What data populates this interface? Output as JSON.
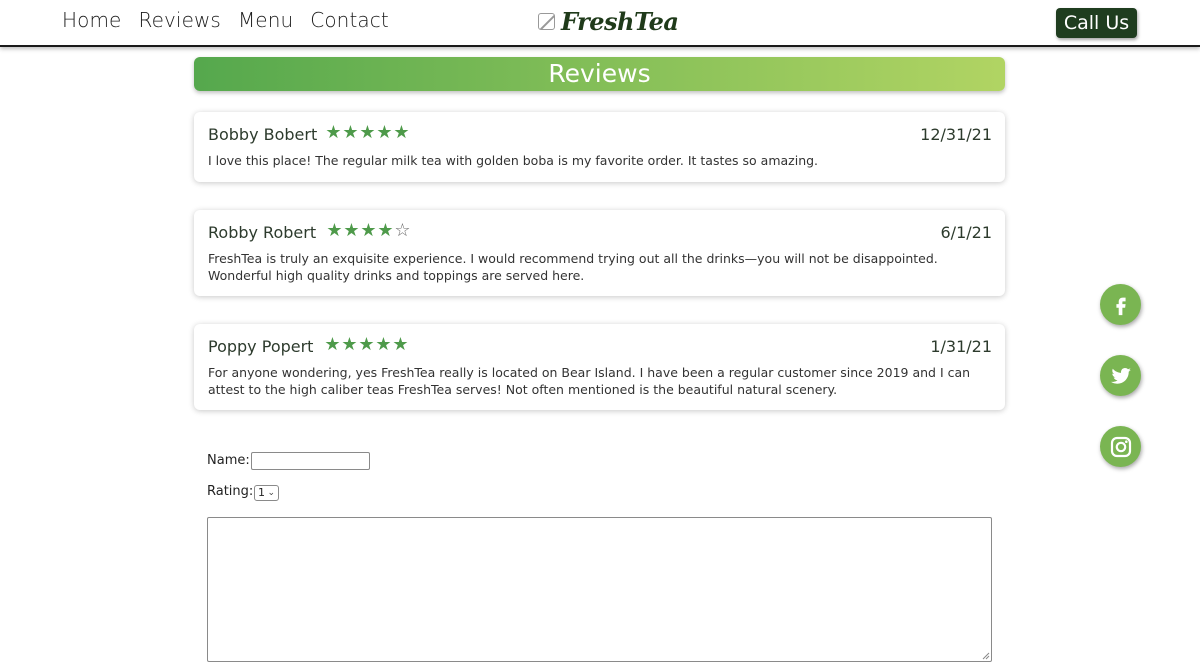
{
  "nav": {
    "items": [
      "Home",
      "Reviews",
      "Menu",
      "Contact"
    ]
  },
  "logo": {
    "text": "FreshTea",
    "icon": "leaf-square-icon"
  },
  "header": {
    "call_label": "Call Us"
  },
  "banner": {
    "title": "Reviews"
  },
  "reviews": [
    {
      "name": "Bobby Bobert",
      "rating": 5,
      "date": "12/31/21",
      "text": "I love this place! The regular milk tea with golden boba is my favorite order. It tastes so amazing."
    },
    {
      "name": "Robby Robert",
      "rating": 4,
      "date": "6/1/21",
      "text": "FreshTea is truly an exquisite experience. I would recommend trying out all the drinks—you will not be disappointed. Wonderful high quality drinks and toppings are served here."
    },
    {
      "name": "Poppy Popert",
      "rating": 5,
      "date": "1/31/21",
      "text": "For anyone wondering, yes FreshTea really is located on Bear Island. I have been a regular customer since 2019 and I can attest to the high caliber teas FreshTea serves! Not often mentioned is the beautiful natural scenery."
    }
  ],
  "social": {
    "icons": [
      "facebook-icon",
      "twitter-icon",
      "instagram-icon"
    ]
  },
  "form": {
    "name_label": "Name:",
    "name_value": "",
    "rating_label": "Rating:",
    "rating_value": "1",
    "review_value": ""
  },
  "colors": {
    "star": "#4e9a4a",
    "accent_green": "#7ab552",
    "call_button": "#1f3d1f",
    "banner_start": "#55a84d",
    "banner_end": "#b1d463"
  }
}
